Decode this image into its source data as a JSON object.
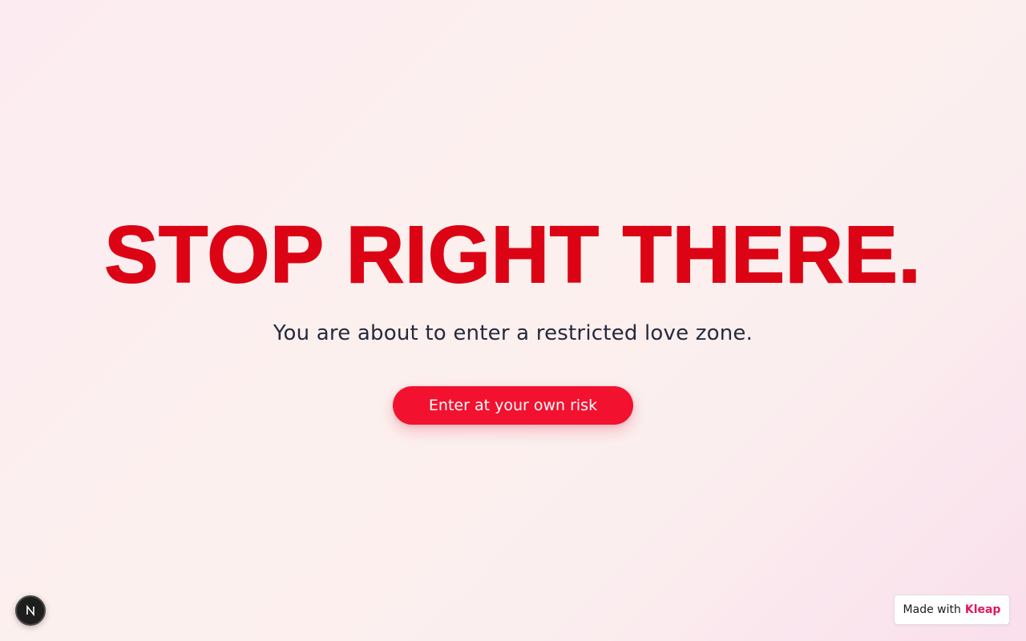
{
  "hero": {
    "headline": "STOP RIGHT THERE.",
    "subtitle": "You are about to enter a restricted love zone.",
    "cta_label": "Enter at your own risk"
  },
  "badges": {
    "next_icon": "nextjs-logo-icon",
    "made_with_prefix": "Made with",
    "made_with_brand": "Kleap"
  },
  "colors": {
    "headline": "#dc0414",
    "button": "#f2122f",
    "brand": "#e6155a",
    "subtitle": "#262a3d"
  }
}
